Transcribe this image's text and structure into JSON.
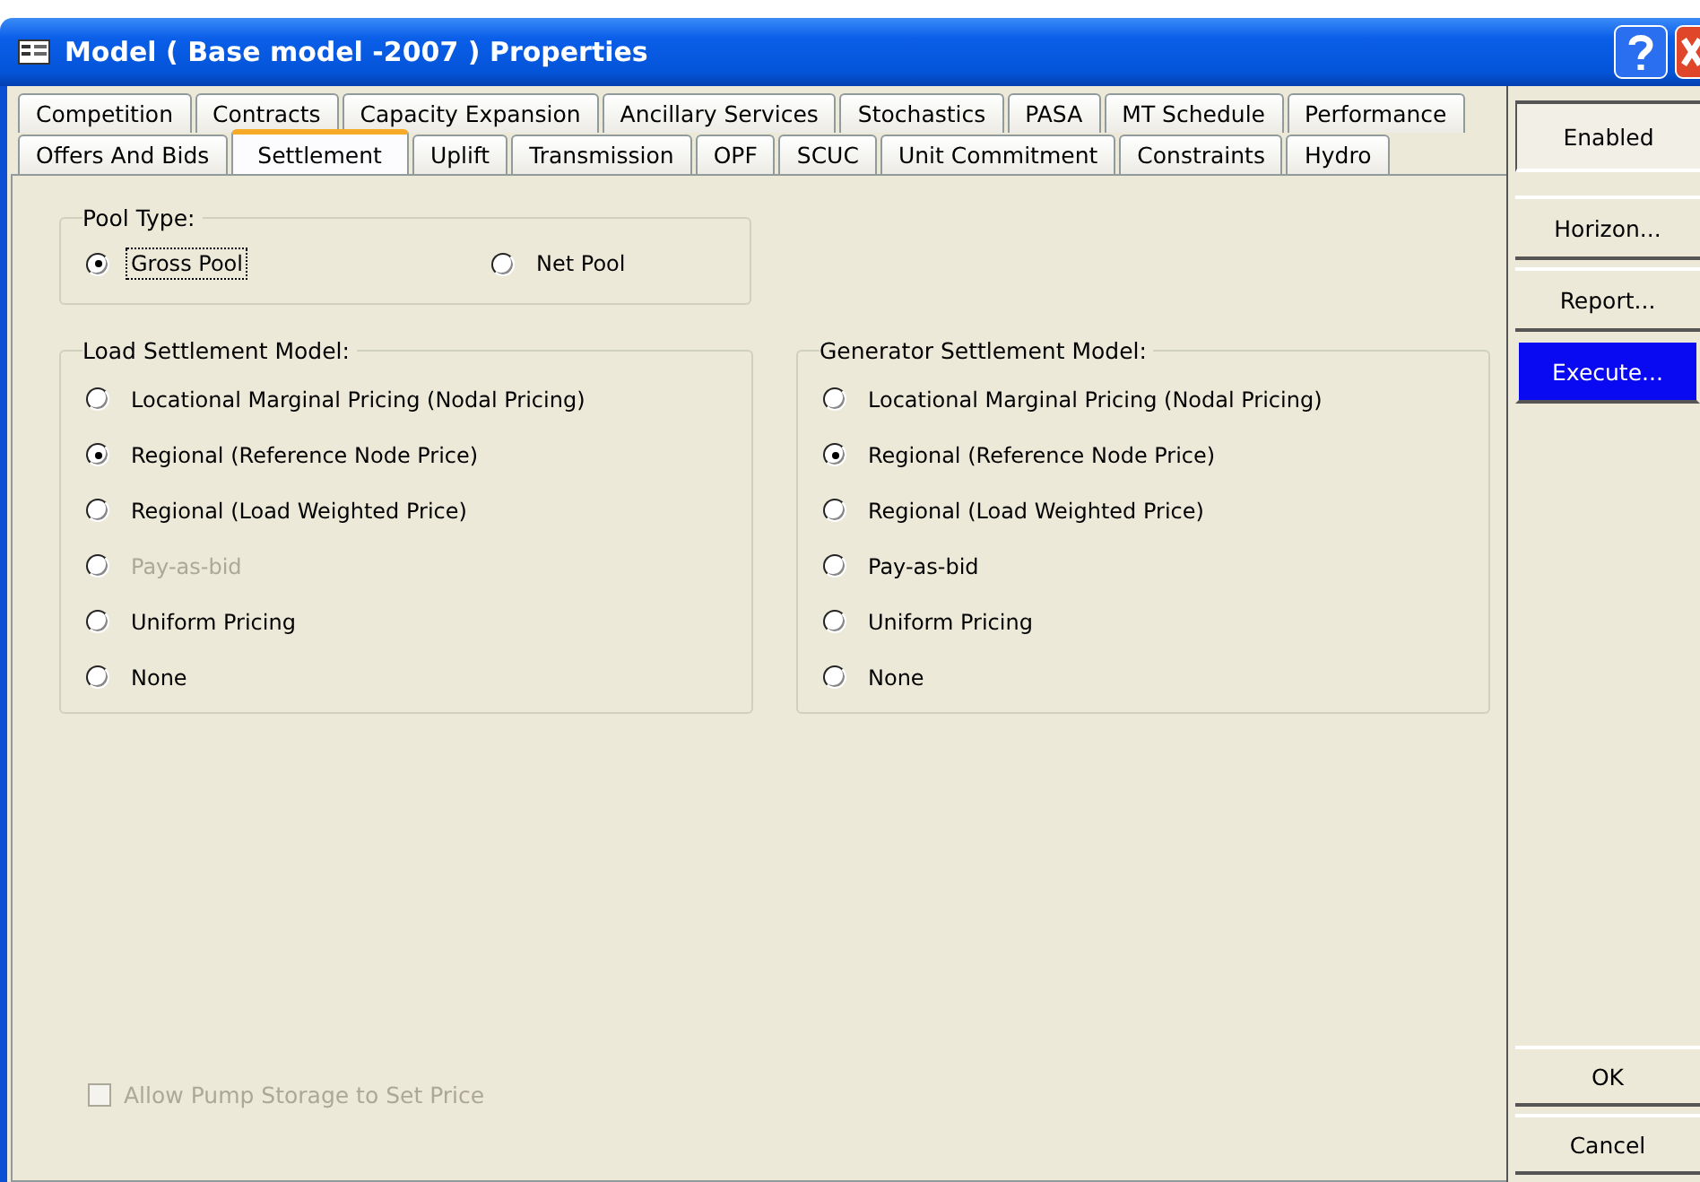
{
  "window": {
    "title": "Model ( Base model -2007 ) Properties"
  },
  "tabs_row_1": [
    {
      "label": "Competition",
      "selected": false
    },
    {
      "label": "Contracts",
      "selected": false
    },
    {
      "label": "Capacity Expansion",
      "selected": false
    },
    {
      "label": "Ancillary Services",
      "selected": false
    },
    {
      "label": "Stochastics",
      "selected": false
    },
    {
      "label": "PASA",
      "selected": false
    },
    {
      "label": "MT Schedule",
      "selected": false
    },
    {
      "label": "Performance",
      "selected": false
    }
  ],
  "tabs_row_2": [
    {
      "label": "Offers And Bids",
      "selected": false
    },
    {
      "label": "Settlement",
      "selected": true
    },
    {
      "label": "Uplift",
      "selected": false
    },
    {
      "label": "Transmission",
      "selected": false
    },
    {
      "label": "OPF",
      "selected": false
    },
    {
      "label": "SCUC",
      "selected": false
    },
    {
      "label": "Unit Commitment",
      "selected": false
    },
    {
      "label": "Constraints",
      "selected": false
    },
    {
      "label": "Hydro",
      "selected": false
    }
  ],
  "pool_type": {
    "title": "Pool Type:",
    "options": [
      {
        "label": "Gross Pool",
        "selected": true,
        "disabled": false
      },
      {
        "label": "Net Pool",
        "selected": false,
        "disabled": false
      }
    ]
  },
  "load_settlement_model": {
    "title": "Load Settlement Model:",
    "options": [
      {
        "label": "Locational Marginal Pricing (Nodal Pricing)",
        "selected": false,
        "disabled": false
      },
      {
        "label": "Regional (Reference Node Price)",
        "selected": true,
        "disabled": false
      },
      {
        "label": "Regional (Load Weighted Price)",
        "selected": false,
        "disabled": false
      },
      {
        "label": "Pay-as-bid",
        "selected": false,
        "disabled": true
      },
      {
        "label": "Uniform Pricing",
        "selected": false,
        "disabled": false
      },
      {
        "label": "None",
        "selected": false,
        "disabled": false
      }
    ]
  },
  "generator_settlement_model": {
    "title": "Generator Settlement Model:",
    "options": [
      {
        "label": "Locational Marginal Pricing (Nodal Pricing)",
        "selected": false,
        "disabled": false
      },
      {
        "label": "Regional (Reference Node Price)",
        "selected": true,
        "disabled": false
      },
      {
        "label": "Regional (Load Weighted Price)",
        "selected": false,
        "disabled": false
      },
      {
        "label": "Pay-as-bid",
        "selected": false,
        "disabled": false
      },
      {
        "label": "Uniform Pricing",
        "selected": false,
        "disabled": false
      },
      {
        "label": "None",
        "selected": false,
        "disabled": false
      }
    ]
  },
  "pump_storage_checkbox": {
    "label": "Allow Pump Storage to Set Price",
    "checked": false,
    "disabled": true
  },
  "side_buttons_top": [
    {
      "label": "Enabled",
      "pressed": true,
      "highlighted": false
    },
    {
      "label": "Horizon...",
      "pressed": false,
      "highlighted": false
    },
    {
      "label": "Report...",
      "pressed": false,
      "highlighted": false
    },
    {
      "label": "Execute...",
      "pressed": false,
      "highlighted": true
    }
  ],
  "side_buttons_bottom": [
    {
      "label": "OK",
      "pressed": false,
      "highlighted": false
    },
    {
      "label": "Cancel",
      "pressed": false,
      "highlighted": false
    }
  ]
}
